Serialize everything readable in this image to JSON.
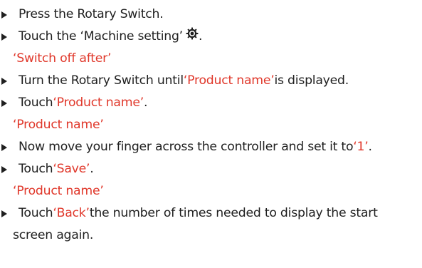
{
  "steps": [
    {
      "pre": "Press the Rotary Switch."
    },
    {
      "pre": "Touch the ‘Machine setting’",
      "icon": "gear-icon",
      "post": "."
    },
    {
      "result": "‘Switch off after’"
    },
    {
      "pre": "Turn the Rotary Switch until ",
      "hl": "‘Product name’",
      "post": " is displayed."
    },
    {
      "pre": "Touch ",
      "hl": "‘Product name’",
      "post": "."
    },
    {
      "result": "‘Product name’"
    },
    {
      "pre": "Now move your finger across the controller and set it to ",
      "hl": "‘1’",
      "post": "."
    },
    {
      "pre": "Touch ",
      "hl": "‘Save’",
      "post": "."
    },
    {
      "result": "‘Product name’"
    },
    {
      "pre": "Touch ",
      "hl": "‘Back’",
      "post": " the number of times needed to display the start",
      "cont": "screen again."
    }
  ],
  "colors": {
    "text": "#1f1f1f",
    "highlight": "#e0382b"
  }
}
